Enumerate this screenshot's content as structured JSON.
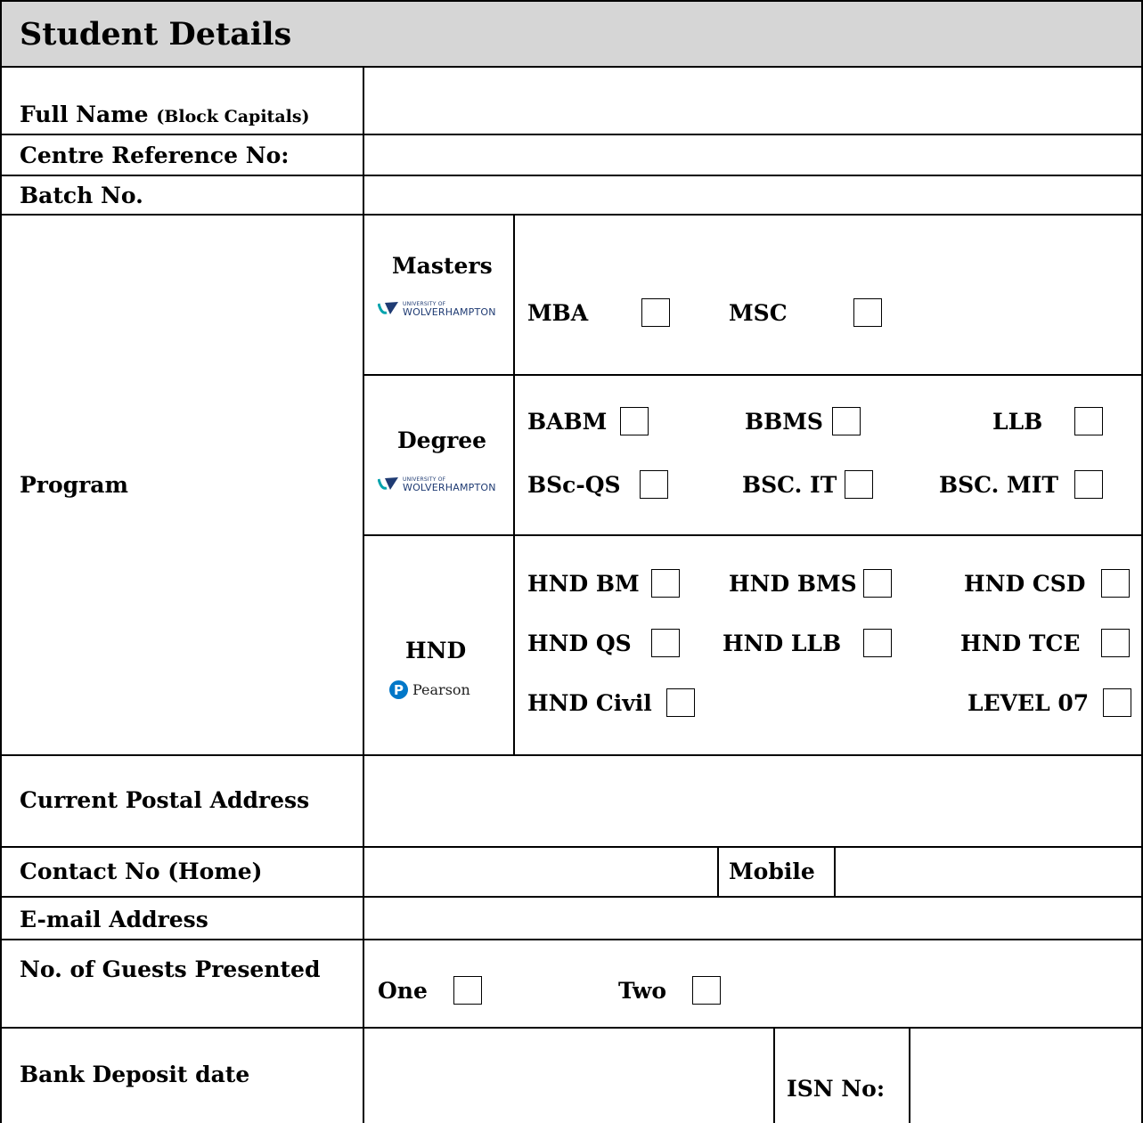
{
  "title": "Student Details",
  "fields": {
    "full_name": "Full Name",
    "full_name_note": "(Block Capitals)",
    "centre_ref": "Centre Reference No:",
    "batch": "Batch No.",
    "program": "Program",
    "postal": "Current Postal Address",
    "contact_home": "Contact No (Home)",
    "mobile": "Mobile",
    "email": "E-mail Address",
    "guests": "No. of Guests Presented",
    "bank_date": "Bank Deposit date",
    "isn": "ISN No:"
  },
  "program": {
    "masters": {
      "label": "Masters",
      "logo_line1": "UNIVERSITY OF",
      "logo_line2": "WOLVERHAMPTON",
      "options": [
        "MBA",
        "MSC"
      ]
    },
    "degree": {
      "label": "Degree",
      "logo_line1": "UNIVERSITY OF",
      "logo_line2": "WOLVERHAMPTON",
      "options": [
        "BABM",
        "BBMS",
        "LLB",
        "BSc-QS",
        "BSC. IT",
        "BSC. MIT"
      ]
    },
    "hnd": {
      "label": "HND",
      "logo_text": "Pearson",
      "options": [
        "HND BM",
        "HND BMS",
        "HND CSD",
        "HND QS",
        "HND LLB",
        "HND TCE",
        "HND Civil",
        "LEVEL 07"
      ]
    }
  },
  "guests": {
    "options": [
      "One",
      "Two"
    ]
  },
  "colors": {
    "header_bg": "#d6d6d6",
    "wlv_navy": "#1f3b73",
    "wlv_teal": "#00a3ad",
    "pearson_blue": "#0077c8"
  }
}
